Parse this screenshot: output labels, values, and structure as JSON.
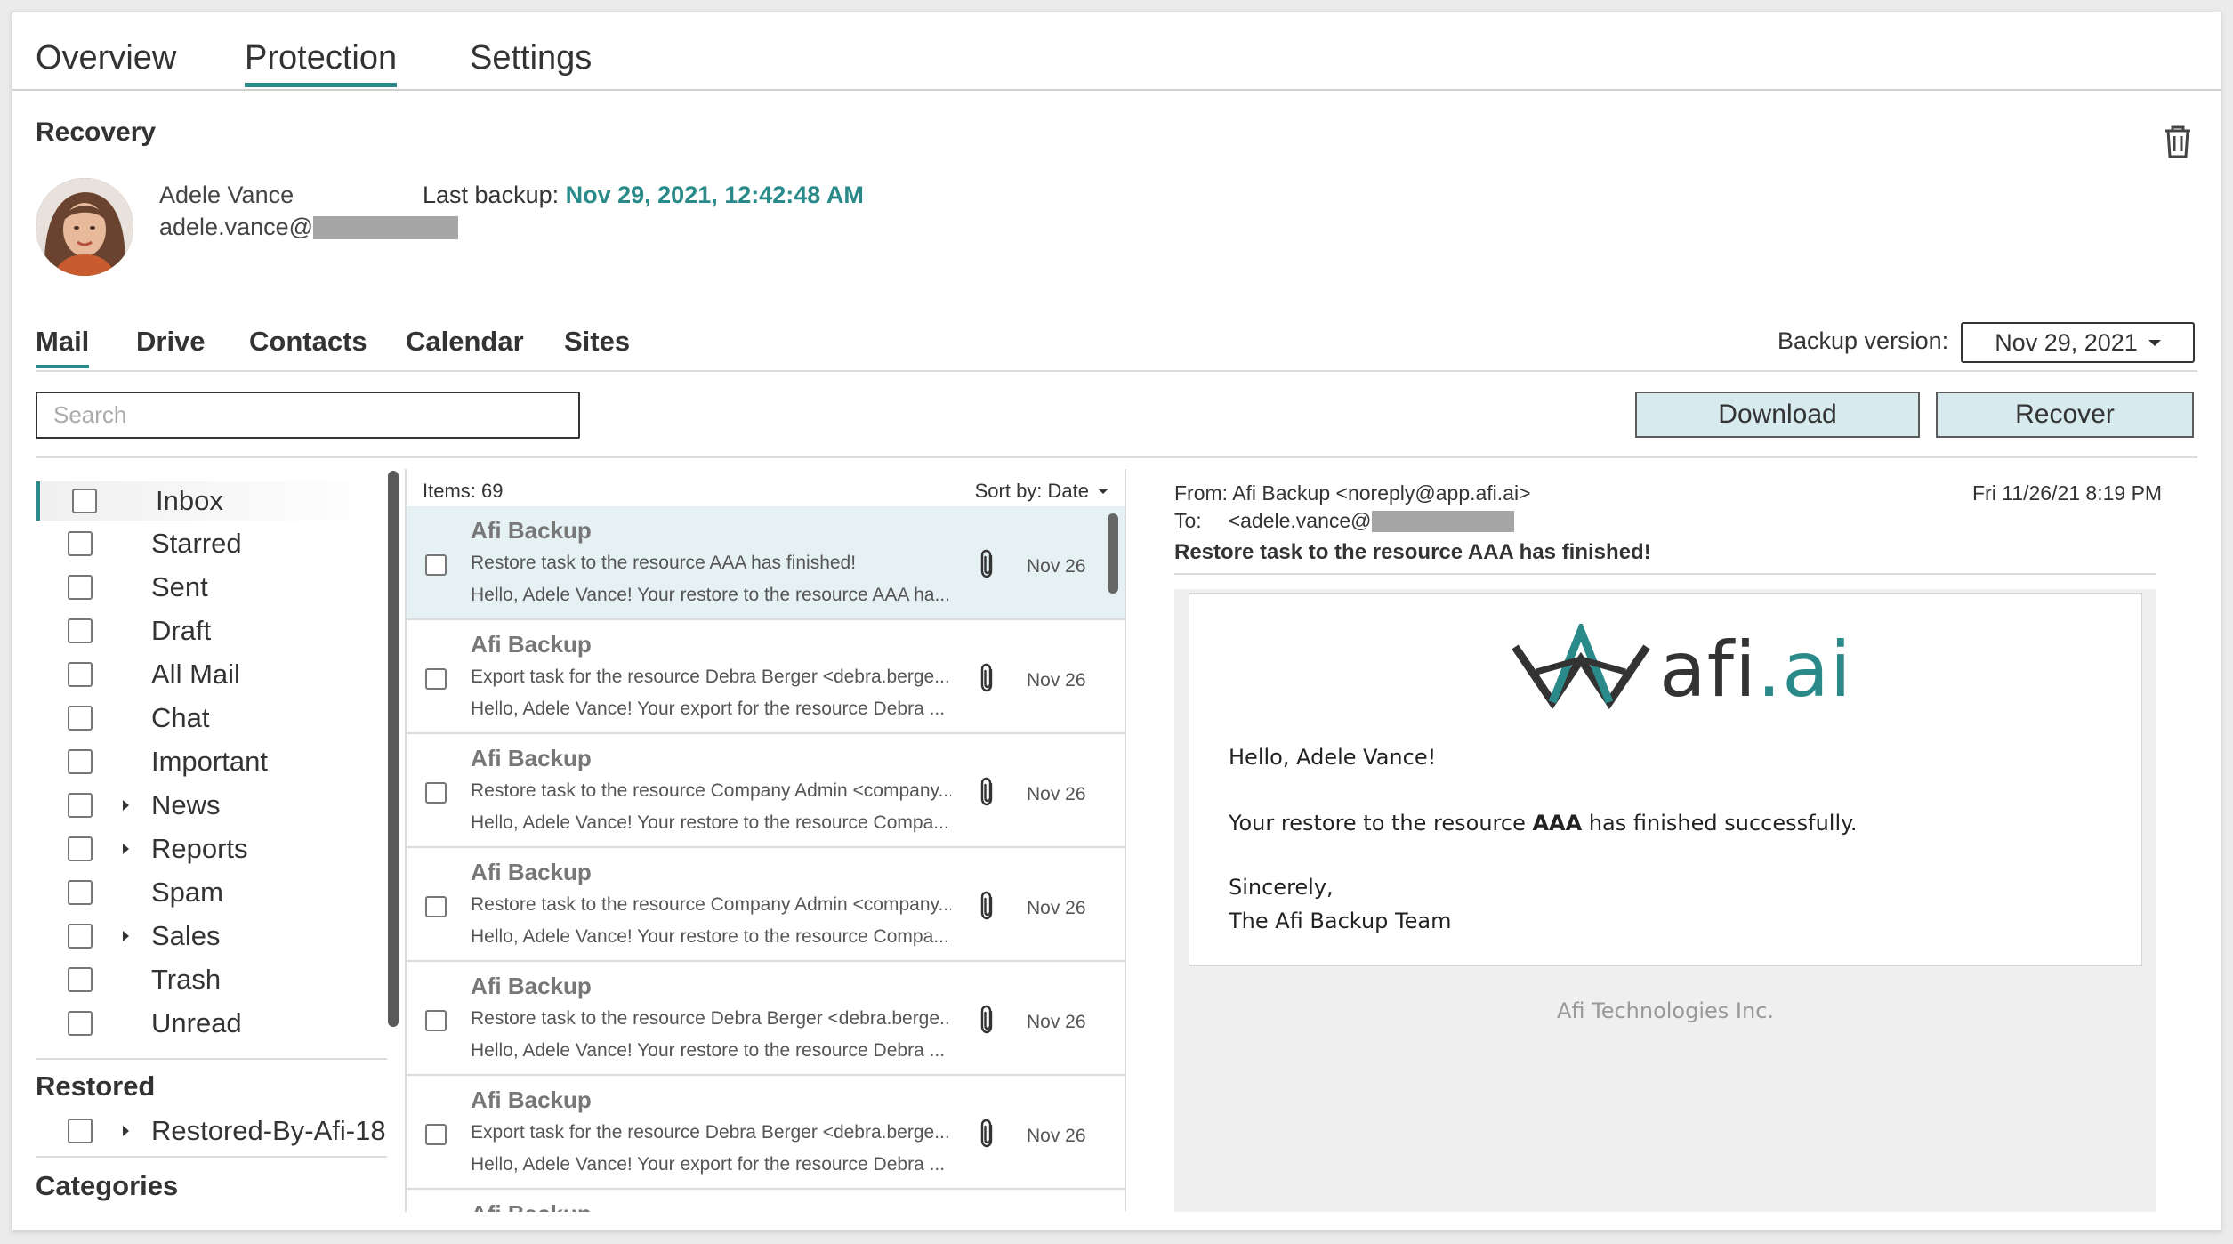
{
  "top_tabs": [
    "Overview",
    "Protection",
    "Settings"
  ],
  "active_top_tab": "Protection",
  "section_title": "Recovery",
  "user": {
    "name": "Adele Vance",
    "email_prefix": "adele.vance@"
  },
  "last_backup": {
    "label": "Last backup:",
    "value": "Nov 29, 2021, 12:42:48 AM"
  },
  "service_tabs": [
    "Mail",
    "Drive",
    "Contacts",
    "Calendar",
    "Sites"
  ],
  "active_service_tab": "Mail",
  "backup_version": {
    "label": "Backup version:",
    "value": "Nov 29, 2021"
  },
  "search": {
    "placeholder": "Search"
  },
  "actions": {
    "download": "Download",
    "recover": "Recover"
  },
  "folders": [
    {
      "label": "Inbox",
      "expandable": false,
      "active": true
    },
    {
      "label": "Starred",
      "expandable": false
    },
    {
      "label": "Sent",
      "expandable": false
    },
    {
      "label": "Draft",
      "expandable": false
    },
    {
      "label": "All Mail",
      "expandable": false
    },
    {
      "label": "Chat",
      "expandable": false
    },
    {
      "label": "Important",
      "expandable": false
    },
    {
      "label": "News",
      "expandable": true
    },
    {
      "label": "Reports",
      "expandable": true
    },
    {
      "label": "Spam",
      "expandable": false
    },
    {
      "label": "Sales",
      "expandable": true
    },
    {
      "label": "Trash",
      "expandable": false
    },
    {
      "label": "Unread",
      "expandable": false
    }
  ],
  "restored": {
    "title": "Restored",
    "items": [
      {
        "label": "Restored-By-Afi-18-...",
        "expandable": true
      }
    ]
  },
  "categories": {
    "title": "Categories"
  },
  "list": {
    "items_count": "Items: 69",
    "sort_label": "Sort by: Date",
    "messages": [
      {
        "sender": "Afi Backup",
        "subject": "Restore task to the resource AAA has finished!",
        "preview": "Hello, Adele Vance! Your restore to the resource AAA ha...",
        "date": "Nov 26",
        "active": true
      },
      {
        "sender": "Afi Backup",
        "subject": "Export task for the resource Debra Berger <debra.berge...",
        "preview": "Hello, Adele Vance! Your export for the resource Debra ...",
        "date": "Nov 26"
      },
      {
        "sender": "Afi Backup",
        "subject": "Restore task to the resource Company Admin <company...",
        "preview": "Hello, Adele Vance! Your restore to the resource Compa...",
        "date": "Nov 26"
      },
      {
        "sender": "Afi Backup",
        "subject": "Restore task to the resource Company Admin <company...",
        "preview": "Hello, Adele Vance! Your restore to the resource Compa...",
        "date": "Nov 26"
      },
      {
        "sender": "Afi Backup",
        "subject": "Restore task to the resource Debra Berger <debra.berge...",
        "preview": "Hello, Adele Vance! Your restore to the resource Debra ...",
        "date": "Nov 26"
      },
      {
        "sender": "Afi Backup",
        "subject": "Export task for the resource Debra Berger <debra.berge...",
        "preview": "Hello, Adele Vance! Your export for the resource Debra ...",
        "date": "Nov 26"
      },
      {
        "sender": "Afi Backup",
        "subject": "",
        "preview": "",
        "date": ""
      }
    ]
  },
  "preview": {
    "from_label": "From:",
    "from": "Afi Backup <noreply@app.afi.ai>",
    "to_label": "To:",
    "to_prefix": "<adele.vance@",
    "date": "Fri 11/26/21 8:19 PM",
    "subject": "Restore task to the resource AAA has finished!",
    "logo_text": "afi",
    "logo_text_accent": ".ai",
    "greeting": "Hello, Adele Vance!",
    "body_before": "Your restore to the resource ",
    "body_bold": "AAA",
    "body_after": " has finished successfully.",
    "signoff_1": "Sincerely,",
    "signoff_2": "The Afi Backup Team",
    "footer": "Afi Technologies Inc."
  },
  "colors": {
    "accent": "#2a8a8a",
    "button_bg": "#d7eaee",
    "selected_row": "#e6f1f3"
  },
  "icons": {
    "trash": "trash-icon",
    "attachment": "paperclip-icon",
    "dropdown": "chevron-down-icon",
    "expand": "caret-right-icon"
  }
}
